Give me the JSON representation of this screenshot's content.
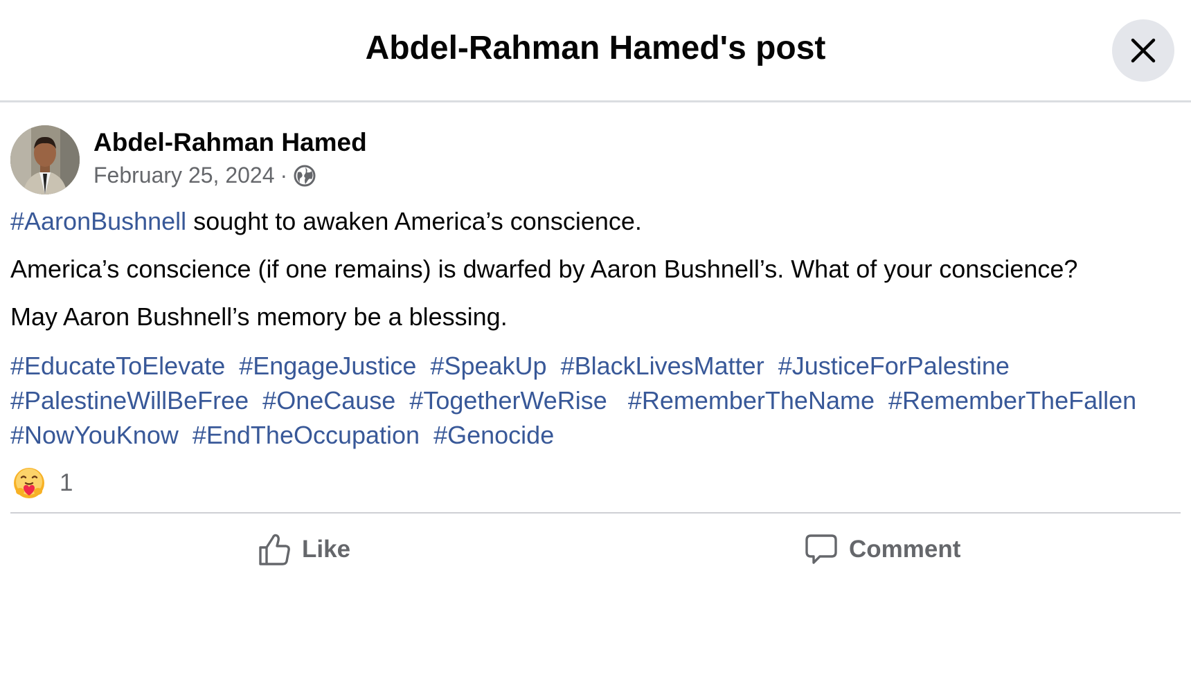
{
  "header": {
    "title": "Abdel-Rahman Hamed's post",
    "close_icon": "close-icon"
  },
  "post": {
    "author": "Abdel-Rahman Hamed",
    "date": "February 25, 2024",
    "separator": "·",
    "privacy_icon": "globe-icon",
    "paragraph1_hashtag": "#AaronBushnell",
    "paragraph1_text": " sought to awaken America’s conscience.",
    "paragraph2": "America’s conscience (if one remains) is dwarfed by Aaron Bushnell’s. What of your conscience?",
    "paragraph3": "May Aaron Bushnell’s memory be a blessing.",
    "hashtags": [
      "#EducateToElevate",
      "#EngageJustice",
      "#SpeakUp",
      "#BlackLivesMatter",
      "#JusticeForPalestine",
      "#PalestineWillBeFree",
      "#OneCause",
      "#TogetherWeRise",
      "#RememberTheName",
      "#RememberTheFallen",
      "#NowYouKnow",
      "#EndTheOccupation",
      "#Genocide"
    ]
  },
  "reactions": {
    "icon": "care-reaction-icon",
    "count": "1"
  },
  "actions": {
    "like_label": "Like",
    "comment_label": "Comment"
  },
  "colors": {
    "link": "#385898",
    "secondary_text": "#65676b",
    "close_bg": "#e4e6eb",
    "divider": "#ced0d4"
  }
}
